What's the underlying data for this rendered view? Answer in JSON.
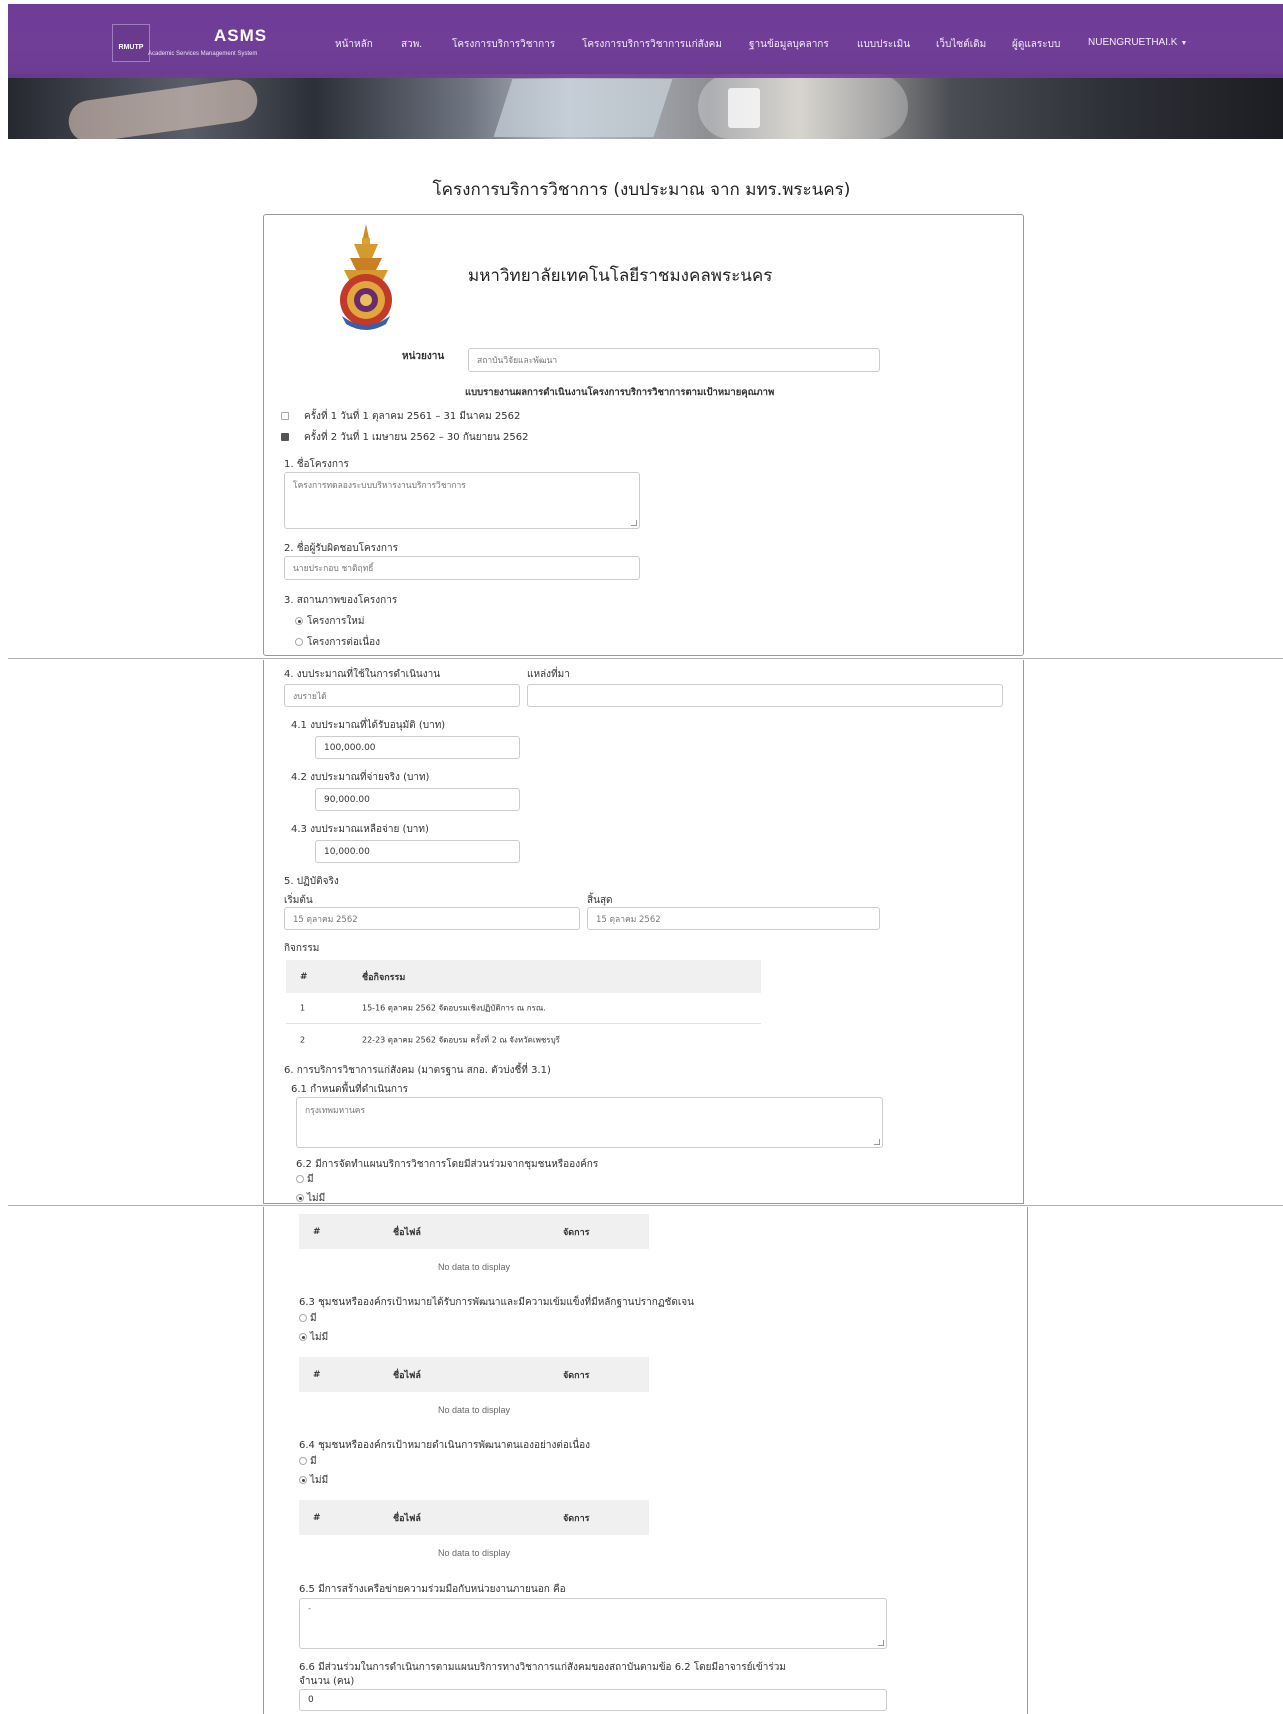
{
  "header": {
    "logo_text": "RMUTP",
    "brand_title": "ASMS",
    "brand_subtitle": "Academic Services Management System",
    "nav": [
      "หน้าหลัก",
      "สวพ.",
      "โครงการบริการวิชาการ",
      "โครงการบริการวิชาการแก่สังคม",
      "ฐานข้อมูลบุคลากร",
      "แบบประเมิน",
      "เว็บไซต์เดิม",
      "ผู้ดูแลระบบ",
      "NUENGRUETHAI.K"
    ]
  },
  "page_title": "โครงการบริการวิชาการ (งบประมาณ จาก มทร.พระนคร)",
  "university_name": "มหาวิทยาลัยเทคโนโลยีราชมงคลพระนคร",
  "unit": {
    "label": "หน่วยงาน",
    "value": "สถาบันวิจัยและพัฒนา"
  },
  "report_heading": "แบบรายงานผลการดำเนินงานโครงการบริการวิชาการตามเป้าหมายคุณภาพ",
  "periods": [
    {
      "label": "ครั้งที่ 1 วันที่ 1 ตุลาคม 2561 – 31 มีนาคม 2562",
      "checked": false
    },
    {
      "label": "ครั้งที่ 2 วันที่ 1 เมษายน 2562 – 30 กันยายน 2562",
      "checked": true
    }
  ],
  "q1": {
    "label": "1. ชื่อโครงการ",
    "value": "โครงการทดลองระบบบริหารงานบริการวิชาการ"
  },
  "q2": {
    "label": "2. ชื่อผู้รับผิดชอบโครงการ",
    "value": "นายประกอบ ชาติฤทธิ์"
  },
  "q3": {
    "label": "3. สถานภาพของโครงการ",
    "options": [
      {
        "label": "โครงการใหม่",
        "checked": true
      },
      {
        "label": "โครงการต่อเนื่อง",
        "checked": false
      }
    ]
  },
  "q4": {
    "label": "4. งบประมาณที่ใช้ในการดำเนินงาน",
    "source_label": "แหล่งที่มา",
    "budget_type": "งบรายได้",
    "source_value": "",
    "approved_label": "4.1 งบประมาณที่ได้รับอนุมัติ (บาท)",
    "approved_value": "100,000.00",
    "spent_label": "4.2 งบประมาณที่จ่ายจริง (บาท)",
    "spent_value": "90,000.00",
    "remaining_label": "4.3 งบประมาณเหลือจ่าย (บาท)",
    "remaining_value": "10,000.00"
  },
  "q5": {
    "label": "5. ปฏิบัติจริง",
    "start_label": "เริ่มต้น",
    "start_value": "15 ตุลาคม 2562",
    "end_label": "สิ้นสุด",
    "end_value": "15 ตุลาคม 2562",
    "activities_label": "กิจกรรม",
    "table_headers": [
      "#",
      "ชื่อกิจกรรม"
    ],
    "activities": [
      {
        "no": "1",
        "name": "15-16 ตุลาคม 2562 จัดอบรมเชิงปฏิบัติการ ณ กรณ."
      },
      {
        "no": "2",
        "name": "22-23 ตุลาคม 2562 จัดอบรม ครั้งที่ 2 ณ จังหวัดเพชรบุรี"
      }
    ]
  },
  "q6": {
    "label": "6. การบริการวิชาการแก่สังคม (มาตรฐาน สกอ. ตัวบ่งชี้ที่ 3.1)",
    "area_label": "6.1 กำหนดพื้นที่ดำเนินการ",
    "area_value": "กรุงเทพมหานคร",
    "plan_label": "6.2 มีการจัดทำแผนบริการวิชาการโดยมีส่วนร่วมจากชุมชนหรือองค์กร",
    "yes_label": "มี",
    "no_label": "ไม่มี",
    "file_headers": [
      "#",
      "ชื่อไฟล์",
      "จัดการ"
    ],
    "no_data": "No data to display",
    "develop_label": "6.3 ชุมชนหรือองค์กรเป้าหมายได้รับการพัฒนาและมีความเข้มแข็งที่มีหลักฐานปรากฏชัดเจน",
    "self_label": "6.4 ชุมชนหรือองค์กรเป้าหมายดำเนินการพัฒนาตนเองอย่างต่อเนื่อง",
    "network_label": "6.5 มีการสร้างเครือข่ายความร่วมมือกับหน่วยงานภายนอก คือ",
    "network_value": "-",
    "participate_label_1": "6.6 มีส่วนร่วมในการดำเนินการตามแผนบริการทางวิชาการแก่สังคมของสถาบันตามข้อ 6.2 โดยมีอาจารย์เข้าร่วม",
    "participate_label_2": "จำนวน (คน)",
    "participate_value": "0"
  }
}
